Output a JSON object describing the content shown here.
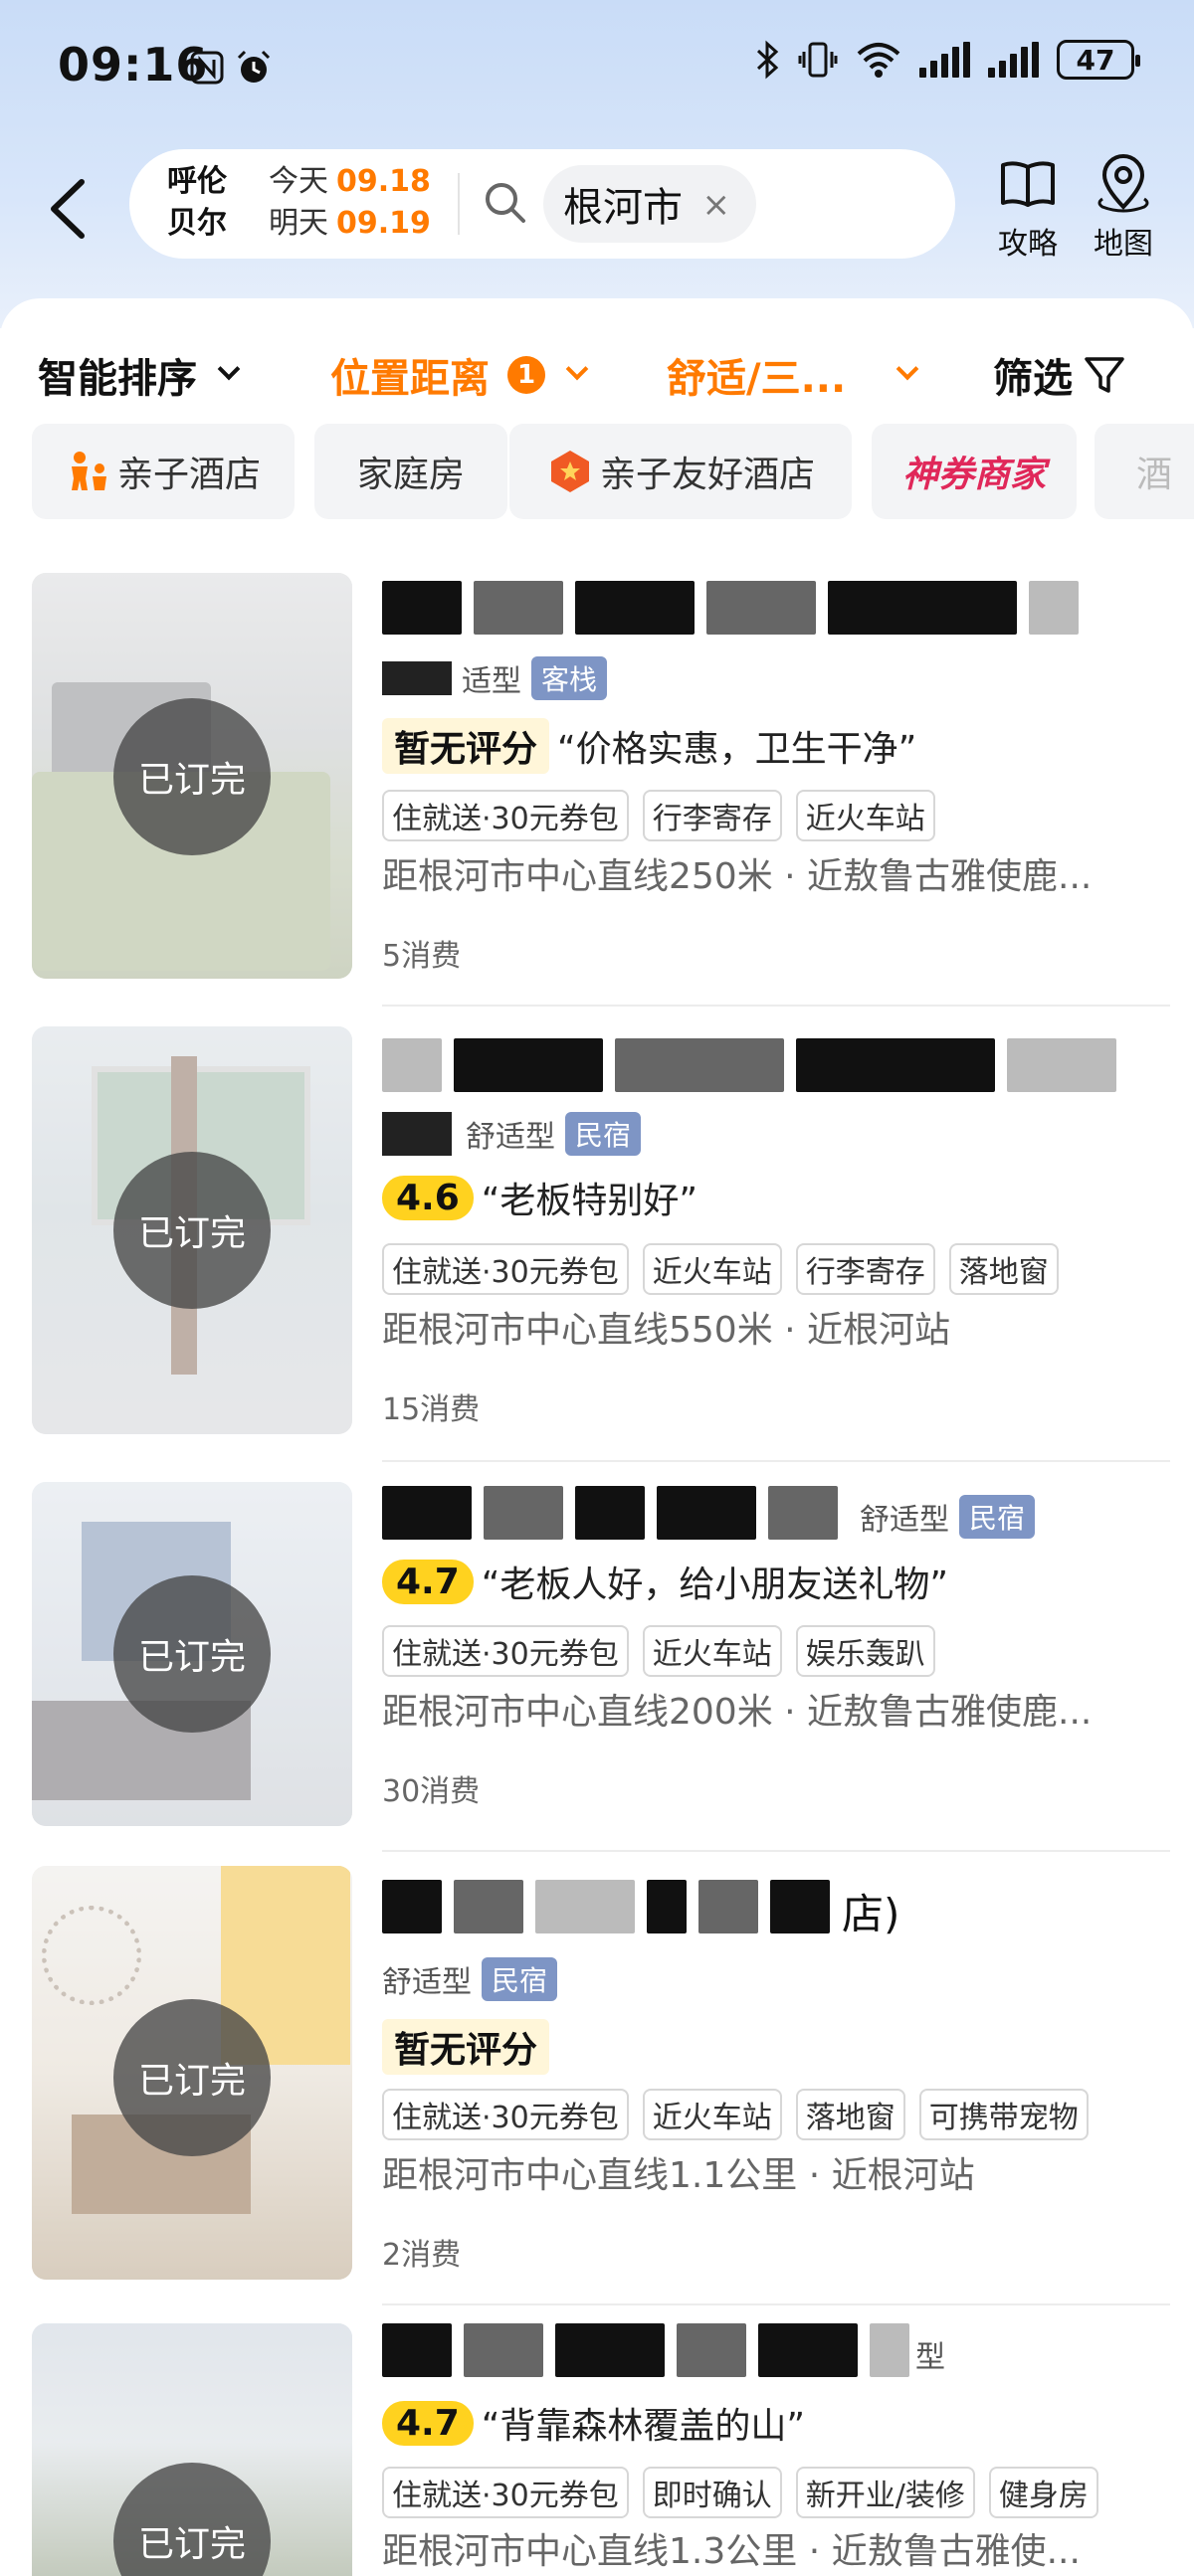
{
  "status_bar": {
    "time": "09:16",
    "battery": "47",
    "left_icons": [
      "nfc-icon",
      "alarm-icon"
    ],
    "right_icons": [
      "bluetooth-icon",
      "vibrate-icon",
      "wifi-icon",
      "signal-icon",
      "signal-icon",
      "battery-icon"
    ]
  },
  "search": {
    "city_line1": "呼伦",
    "city_line2": "贝尔",
    "today_label": "今天",
    "today_date": "09.18",
    "tomorrow_label": "明天",
    "tomorrow_date": "09.19",
    "keyword": "根河市",
    "clear": "×"
  },
  "header_actions": {
    "guide": "攻略",
    "map": "地图"
  },
  "sort_bar": {
    "smart_sort": "智能排序",
    "location": "位置距离",
    "location_count": "1",
    "comfort": "舒适/三...",
    "filter": "筛选"
  },
  "quick_tags": [
    {
      "label": "亲子酒店"
    },
    {
      "label": "家庭房"
    },
    {
      "label": "亲子友好酒店"
    },
    {
      "label": "神券商家"
    },
    {
      "label": "酒"
    }
  ],
  "hotels": [
    {
      "type": "舒适型",
      "type_visible": "适型",
      "category": "客栈",
      "score": "暂无评分",
      "quote": "“价格实惠，卫生干净”",
      "features": [
        "住就送·30元券包",
        "行李寄存",
        "近火车站"
      ],
      "distance": "距根河市中心直线250米 · 近敖鲁古雅使鹿...",
      "consumption": "5消费",
      "status": "已订完"
    },
    {
      "type": "舒适型",
      "category": "民宿",
      "score": "4.6",
      "quote": "“老板特别好”",
      "features": [
        "住就送·30元券包",
        "近火车站",
        "行李寄存",
        "落地窗"
      ],
      "distance": "距根河市中心直线550米 · 近根河站",
      "consumption": "15消费",
      "status": "已订完"
    },
    {
      "type": "舒适型",
      "category": "民宿",
      "score": "4.7",
      "quote": "“老板人好，给小朋友送礼物”",
      "features": [
        "住就送·30元券包",
        "近火车站",
        "娱乐轰趴"
      ],
      "distance": "距根河市中心直线200米 · 近敖鲁古雅使鹿...",
      "consumption": "30消费",
      "status": "已订完"
    },
    {
      "type": "舒适型",
      "category": "民宿",
      "name_tail": "店)",
      "score": "暂无评分",
      "quote": "",
      "features": [
        "住就送·30元券包",
        "近火车站",
        "落地窗",
        "可携带宠物"
      ],
      "distance": "距根河市中心直线1.1公里 · 近根河站",
      "consumption": "2消费",
      "status": "已订完"
    },
    {
      "type": "型",
      "category": "",
      "score": "4.7",
      "quote": "“背靠森林覆盖的山”",
      "features": [
        "住就送·30元券包",
        "即时确认",
        "新开业/装修",
        "健身房"
      ],
      "distance": "距根河市中心直线1.3公里 · 近敖鲁古雅使...",
      "consumption": "",
      "status": "已订完"
    }
  ],
  "colors": {
    "accent": "#ff7a00",
    "score_yellow": "#ffd21f",
    "category_badge": "#7e95c5",
    "coupon_pink": "#e0285a"
  }
}
